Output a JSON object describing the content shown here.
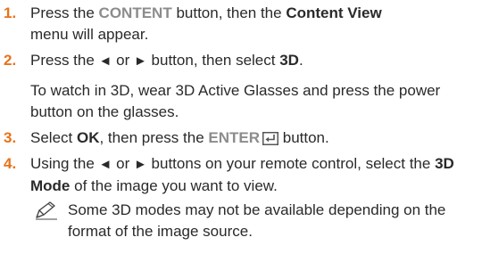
{
  "steps": [
    {
      "number": "1.",
      "text": {
        "press": "Press the ",
        "content_btn": "CONTENT",
        "mid": " button, then the ",
        "content_view": "Content View",
        "end": "menu will appear."
      }
    },
    {
      "number": "2.",
      "text": {
        "pre": "Press the ",
        "left_arrow": "◄",
        "or": " or ",
        "right_arrow": "►",
        "mid": " button, then select ",
        "three_d": "3D",
        "end": "."
      },
      "extra": "To watch in 3D, wear 3D Active Glasses and press the power button on the glasses."
    },
    {
      "number": "3.",
      "text": {
        "pre": "Select ",
        "ok": "OK",
        "mid": ", then press the ",
        "enter": "ENTER",
        "end": " button."
      }
    },
    {
      "number": "4.",
      "text": {
        "pre": "Using the ",
        "left_arrow": "◄",
        "or": " or ",
        "right_arrow": "►",
        "mid": " buttons on your remote control, select the ",
        "mode": "3D Mode",
        "end": " of the image you want to view."
      },
      "note": "Some 3D modes may not be available depending on the format of the image source."
    }
  ],
  "colors": {
    "step_number": "#e8731a",
    "button_text": "#8c8c8c",
    "body_text": "#2a2a2a"
  },
  "icons": {
    "enter": "enter-return-icon",
    "note": "pencil-note-icon"
  }
}
